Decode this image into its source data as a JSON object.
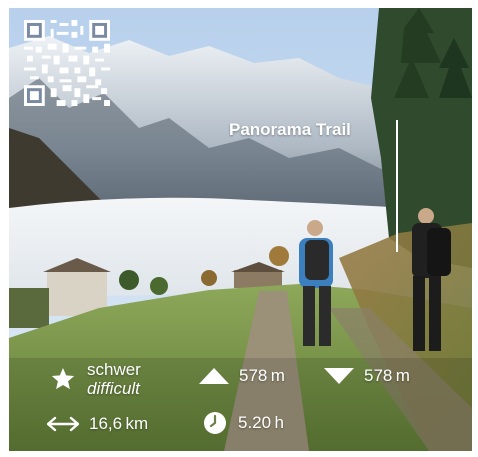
{
  "trail": {
    "title": "Panorama Trail"
  },
  "difficulty": {
    "de": "schwer",
    "en": "difficult",
    "icon": "star-icon"
  },
  "ascent": {
    "value": "578 m",
    "icon": "triangle-up-icon"
  },
  "descent": {
    "value": "578 m",
    "icon": "triangle-down-icon"
  },
  "distance": {
    "value": "16,6 km",
    "icon": "double-arrow-icon"
  },
  "duration": {
    "value": "5.20 h",
    "icon": "clock-icon"
  },
  "qr": {
    "icon": "qr-code-icon"
  },
  "colors": {
    "text": "#ffffff",
    "sky": "#c9dcef",
    "grass": "#7a9a48"
  }
}
